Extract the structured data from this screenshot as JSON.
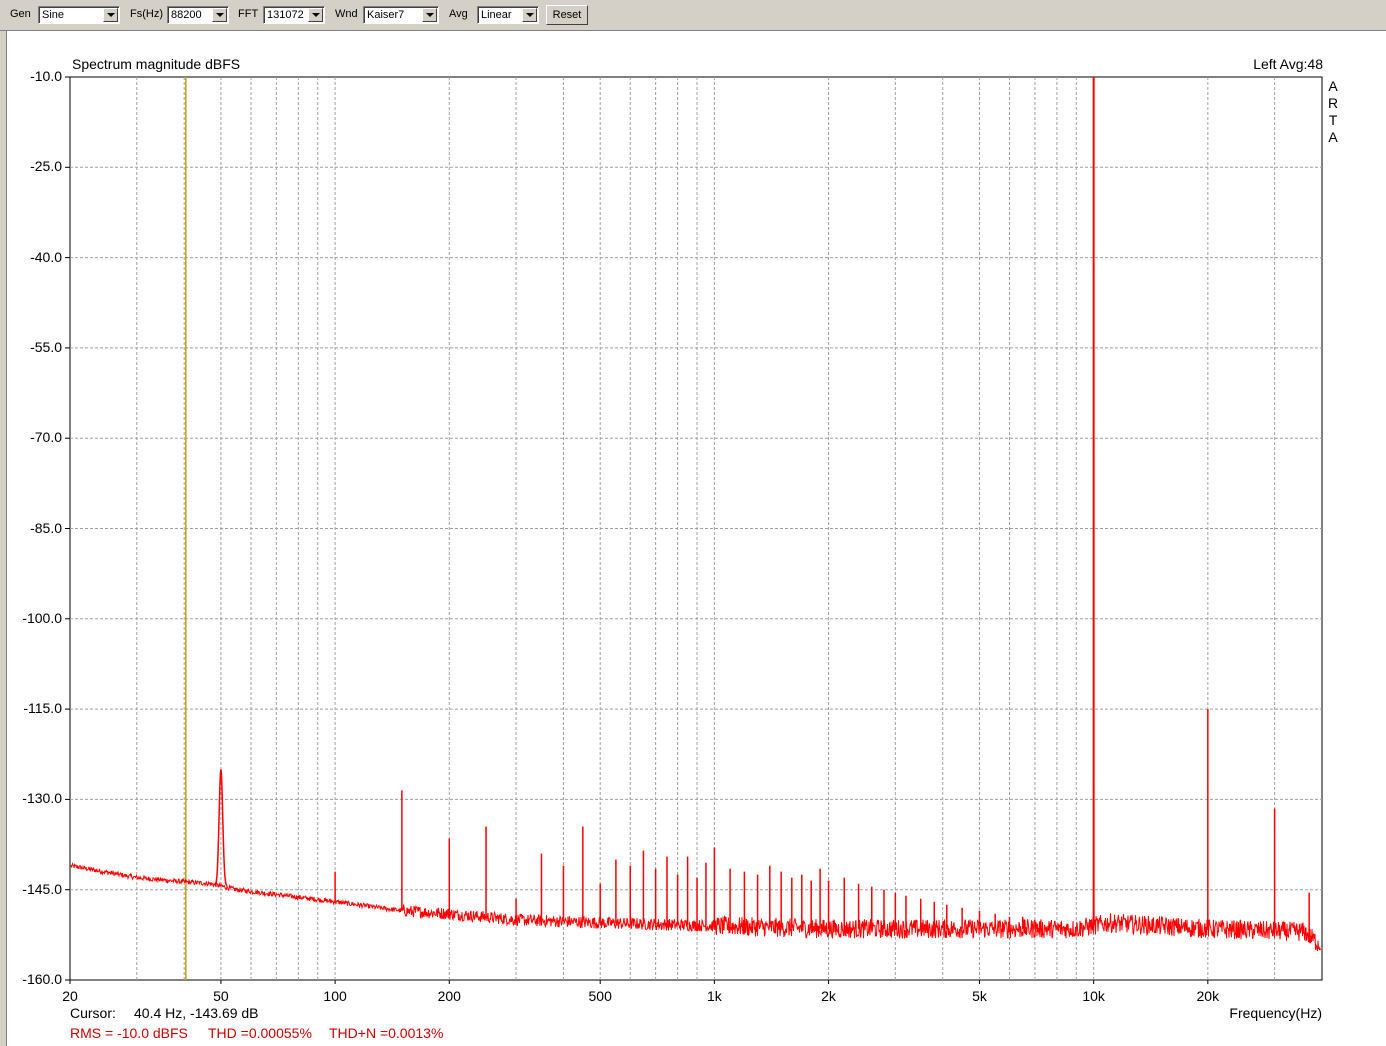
{
  "toolbar": {
    "gen_label": "Gen",
    "gen_value": "Sine",
    "fs_label": "Fs(Hz)",
    "fs_value": "88200",
    "fft_label": "FFT",
    "fft_value": "131072",
    "wnd_label": "Wnd",
    "wnd_value": "Kaiser7",
    "avg_label": "Avg",
    "avg_value": "Linear",
    "reset_label": "Reset"
  },
  "chart_data": {
    "type": "line",
    "title": "Spectrum magnitude dBFS",
    "channel_info": "Left  Avg:48",
    "brand": [
      "A",
      "R",
      "T",
      "A"
    ],
    "xlabel": "Frequency(Hz)",
    "ylabel": "",
    "x_scale": "log",
    "xlim": [
      20,
      40000
    ],
    "ylim": [
      -160,
      -10
    ],
    "y_ticks": [
      -10,
      -25,
      -40,
      -55,
      -70,
      -85,
      -100,
      -115,
      -130,
      -145,
      -160
    ],
    "y_tick_labels": [
      "-10.0",
      "-25.0",
      "-40.0",
      "-55.0",
      "-70.0",
      "-85.0",
      "-100.0",
      "-115.0",
      "-130.0",
      "-145.0",
      "-160.0"
    ],
    "x_ticks": [
      20,
      50,
      100,
      200,
      500,
      1000,
      2000,
      5000,
      10000,
      20000
    ],
    "x_tick_labels": [
      "20",
      "50",
      "100",
      "200",
      "500",
      "1k",
      "2k",
      "5k",
      "10k",
      "20k"
    ],
    "grid": true,
    "colors": {
      "trace": "#ff0000",
      "cursor": "#c8a000",
      "grid": "#a0a0a0"
    },
    "cursor_freq": 40.4,
    "noise_floor": [
      [
        20,
        -141
      ],
      [
        30,
        -143
      ],
      [
        40,
        -143.7
      ],
      [
        47,
        -144
      ],
      [
        55,
        -145
      ],
      [
        100,
        -147
      ],
      [
        150,
        -148.5
      ],
      [
        200,
        -149
      ],
      [
        300,
        -150
      ],
      [
        500,
        -150.5
      ],
      [
        1000,
        -151
      ],
      [
        2000,
        -151.5
      ],
      [
        5000,
        -151.5
      ],
      [
        9000,
        -151.5
      ],
      [
        11000,
        -150.5
      ],
      [
        20000,
        -151.5
      ],
      [
        36000,
        -152
      ],
      [
        40000,
        -154.5
      ]
    ],
    "peaks": [
      {
        "f": 50,
        "db": -125
      },
      {
        "f": 100,
        "db": -142
      },
      {
        "f": 150,
        "db": -128.5
      },
      {
        "f": 200,
        "db": -136.5
      },
      {
        "f": 250,
        "db": -134.5
      },
      {
        "f": 300,
        "db": -146.5
      },
      {
        "f": 350,
        "db": -139
      },
      {
        "f": 400,
        "db": -141
      },
      {
        "f": 450,
        "db": -134.5
      },
      {
        "f": 500,
        "db": -144
      },
      {
        "f": 550,
        "db": -140
      },
      {
        "f": 600,
        "db": -141
      },
      {
        "f": 650,
        "db": -138.5
      },
      {
        "f": 700,
        "db": -141.5
      },
      {
        "f": 750,
        "db": -139.5
      },
      {
        "f": 800,
        "db": -142.5
      },
      {
        "f": 850,
        "db": -139.5
      },
      {
        "f": 900,
        "db": -143
      },
      {
        "f": 950,
        "db": -140.5
      },
      {
        "f": 1000,
        "db": -138
      },
      {
        "f": 1100,
        "db": -141.5
      },
      {
        "f": 1200,
        "db": -142
      },
      {
        "f": 1300,
        "db": -142.5
      },
      {
        "f": 1400,
        "db": -141
      },
      {
        "f": 1500,
        "db": -142
      },
      {
        "f": 1600,
        "db": -143
      },
      {
        "f": 1700,
        "db": -142.5
      },
      {
        "f": 1800,
        "db": -143.5
      },
      {
        "f": 1900,
        "db": -141.5
      },
      {
        "f": 2000,
        "db": -143.5
      },
      {
        "f": 2200,
        "db": -143
      },
      {
        "f": 2400,
        "db": -144
      },
      {
        "f": 2600,
        "db": -144.5
      },
      {
        "f": 2800,
        "db": -145
      },
      {
        "f": 3000,
        "db": -145.5
      },
      {
        "f": 3200,
        "db": -146
      },
      {
        "f": 3500,
        "db": -146.5
      },
      {
        "f": 3800,
        "db": -147
      },
      {
        "f": 4100,
        "db": -147.5
      },
      {
        "f": 4500,
        "db": -148
      },
      {
        "f": 5000,
        "db": -148.5
      },
      {
        "f": 5500,
        "db": -149
      },
      {
        "f": 6000,
        "db": -149.5
      },
      {
        "f": 6500,
        "db": -149.5
      },
      {
        "f": 7000,
        "db": -150
      },
      {
        "f": 10000,
        "db": -10
      },
      {
        "f": 20000,
        "db": -115
      },
      {
        "f": 30000,
        "db": -131.5
      },
      {
        "f": 37000,
        "db": -145.5
      }
    ]
  },
  "readouts": {
    "cursor_label": "Cursor:",
    "cursor_value": "40.4 Hz, -143.69 dB",
    "rms": "RMS =  -10.0 dBFS",
    "thd": "THD =0.00055%",
    "thdn": "THD+N =0.0013%"
  }
}
